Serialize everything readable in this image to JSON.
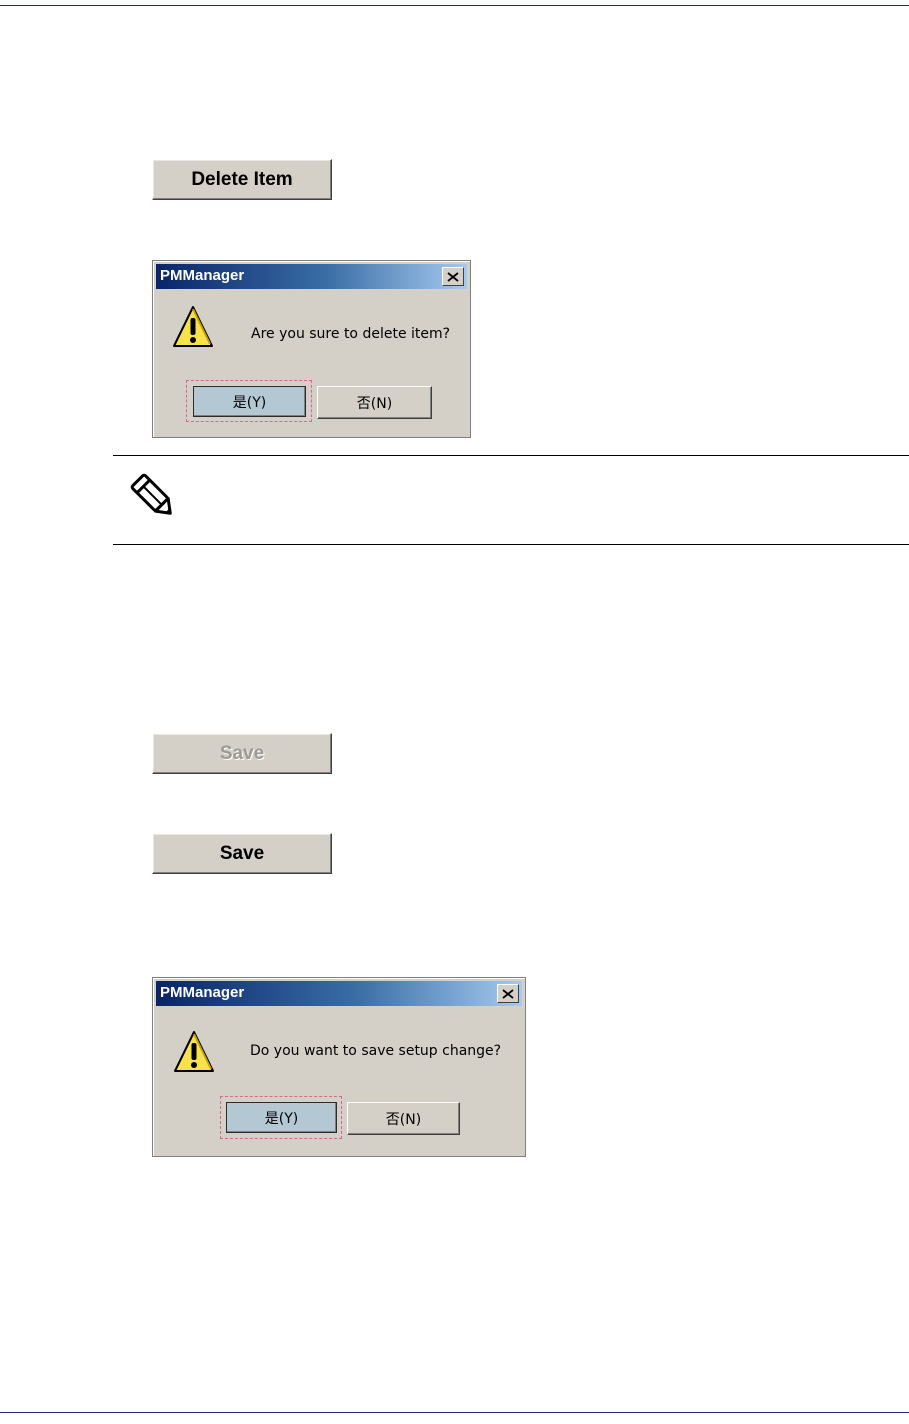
{
  "delete_item_button": {
    "label": "Delete Item"
  },
  "delete_dialog": {
    "title": "PMManager",
    "message": "Are you sure to delete item?",
    "yes_label": "是(Y)",
    "no_label": "否(N)"
  },
  "note": {
    "icon": "pencil-note-icon"
  },
  "save_button_disabled": {
    "label": "Save"
  },
  "save_button_enabled": {
    "label": "Save"
  },
  "save_dialog": {
    "title": "PMManager",
    "message": "Do you want to save setup change?",
    "yes_label": "是(Y)",
    "no_label": "否(N)"
  },
  "colors": {
    "button_face": "#d4d0c8",
    "title_gradient_start": "#0a246a",
    "title_gradient_end": "#a6caf0",
    "focus_dash": "#d9668c",
    "page_rule": "#1e2a78"
  }
}
